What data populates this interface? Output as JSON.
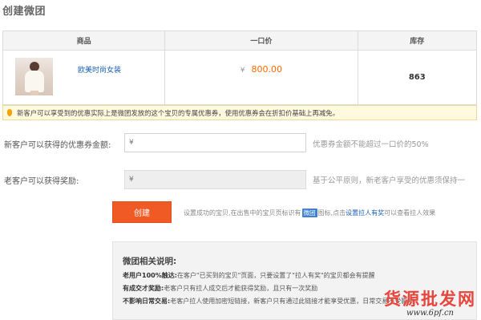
{
  "page_title": "创建微团",
  "table": {
    "headers": [
      "商品",
      "一口价",
      "库存"
    ],
    "row": {
      "product_name": "欧美时尚女装",
      "currency": "¥",
      "price": "800.00",
      "stock": "863"
    }
  },
  "notice": "新客户可以享受到的优惠实际上是微团发放的这个宝贝的专属优惠券，使用优惠券会在折扣价基础上再减免。",
  "form": {
    "new_customer": {
      "label": "新客户可以获得的优惠券金额:",
      "placeholder": "¥",
      "hint": "优惠券金额不能超过一口价的50%"
    },
    "old_customer": {
      "label": "老客户可以获得奖励:",
      "placeholder": "¥",
      "hint": "基于公平原则，新老客户享受的优惠须保持一"
    }
  },
  "create": {
    "button": "创建",
    "tip_before": "设置成功的宝贝,在出售中的宝贝页标识有",
    "tip_tag": "微团",
    "tip_middle": "图标,点击",
    "tip_link": "设置拉人有奖",
    "tip_after": "可以查看拉人效果"
  },
  "info": {
    "title": "微团相关说明:",
    "lines": [
      {
        "bold": "老用户100%触达:",
        "text": "在客户\"已买到的宝贝\"页面，只要设置了\"拉人有奖\"的宝贝都会有提醒"
      },
      {
        "bold": "有成交才奖励:",
        "text": "老客户只有拉人成交后才能获得奖励，且只有一次奖励"
      },
      {
        "bold": "不影响日常交易:",
        "text": "老客户拉人使用加密短链接，新客户只有通过此链接才能享受优惠，日常交易不受影响"
      }
    ]
  },
  "watermark": {
    "text": "货源批发网",
    "url": "www.6pf.cn"
  },
  "colors": {
    "accent": "#f05a24",
    "price": "#ff6a00",
    "link": "#1a5fb4",
    "notice_bg": "#fff9df"
  }
}
